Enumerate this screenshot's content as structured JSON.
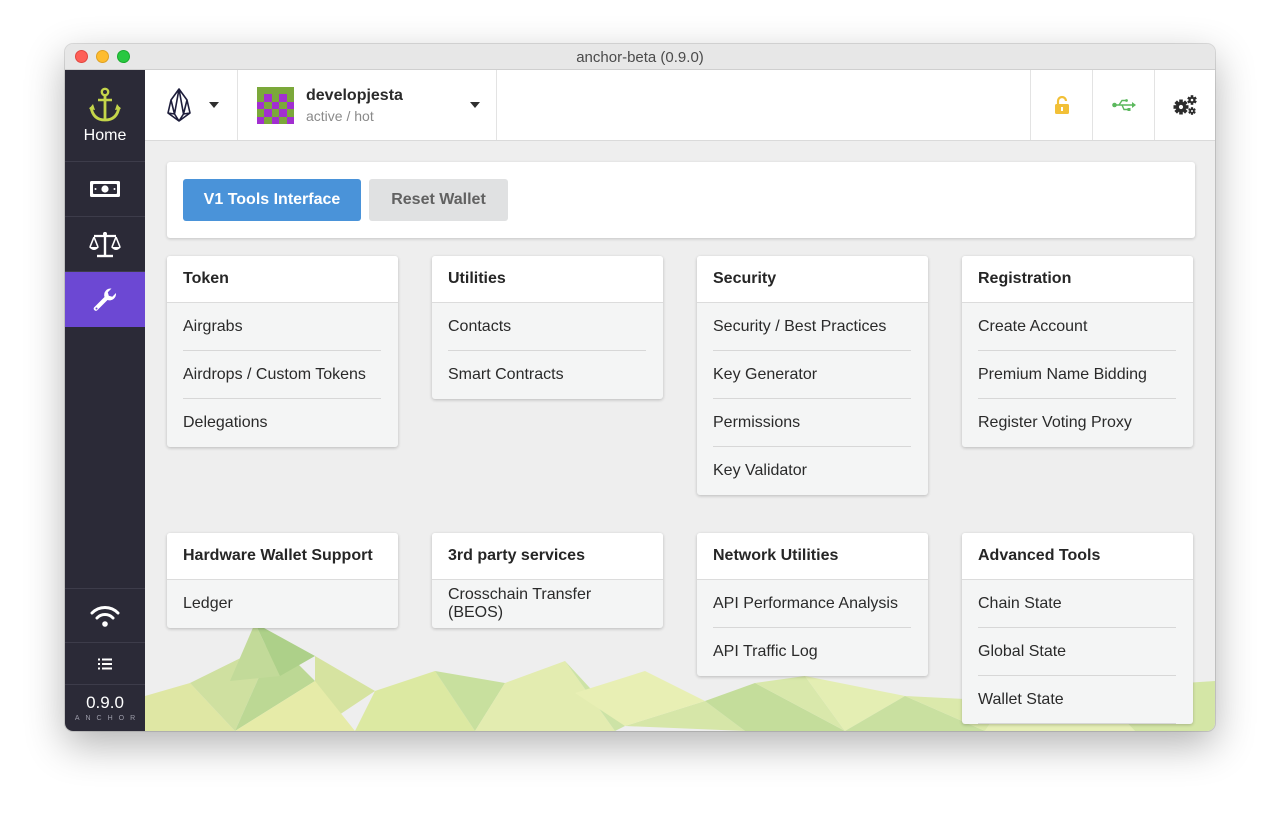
{
  "window": {
    "title": "anchor-beta (0.9.0)"
  },
  "sidebar": {
    "home_label": "Home",
    "version": "0.9.0",
    "brand": "ANCHOR",
    "active_color": "#6c48d3"
  },
  "header": {
    "account_name": "developjesta",
    "account_permission": "active / hot",
    "lock_color": "#f2c037",
    "usb_color": "#5bb85d"
  },
  "toolbar": {
    "primary_label": "V1 Tools Interface",
    "secondary_label": "Reset Wallet"
  },
  "sections": [
    {
      "title": "Token",
      "items": [
        "Airgrabs",
        "Airdrops / Custom Tokens",
        "Delegations"
      ]
    },
    {
      "title": "Utilities",
      "items": [
        "Contacts",
        "Smart Contracts"
      ]
    },
    {
      "title": "Security",
      "items": [
        "Security / Best Practices",
        "Key Generator",
        "Permissions",
        "Key Validator"
      ]
    },
    {
      "title": "Registration",
      "items": [
        "Create Account",
        "Premium Name Bidding",
        "Register Voting Proxy"
      ]
    },
    {
      "title": "Hardware Wallet Support",
      "items": [
        "Ledger"
      ]
    },
    {
      "title": "3rd party services",
      "items": [
        "Crosschain Transfer (BEOS)"
      ]
    },
    {
      "title": "Network Utilities",
      "items": [
        "API Performance Analysis",
        "API Traffic Log"
      ]
    },
    {
      "title": "Advanced Tools",
      "items": [
        "Chain State",
        "Global State",
        "Wallet State"
      ]
    }
  ]
}
